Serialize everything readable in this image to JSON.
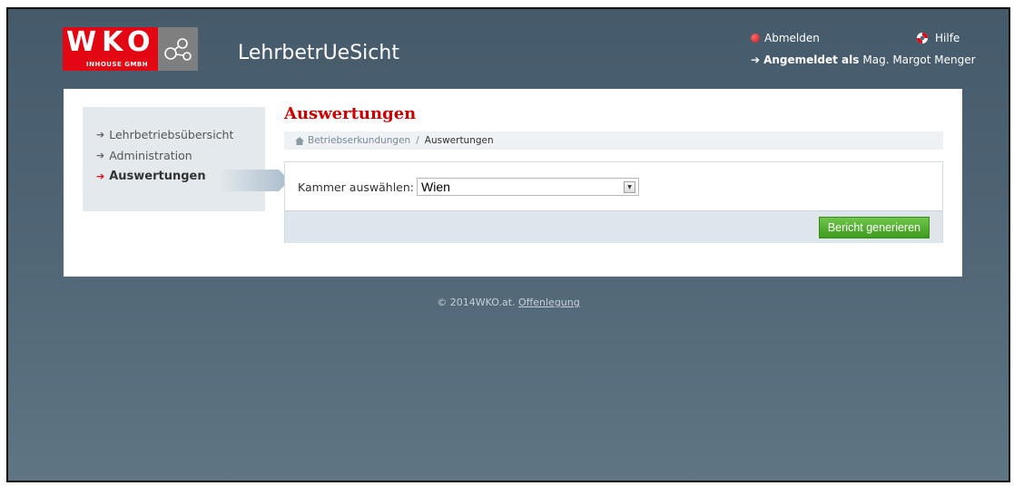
{
  "header": {
    "logo_letters": "WKO",
    "logo_sub": "INHOUSE GMBH",
    "app_title": "LehrbetrUeSicht",
    "logout_label": "Abmelden",
    "help_label": "Hilfe",
    "logged_in_prefix": "Angemeldet als",
    "user_name": "Mag. Margot Menger"
  },
  "sidebar": {
    "items": [
      {
        "label": "Lehrbetriebsübersicht",
        "active": false
      },
      {
        "label": "Administration",
        "active": false
      },
      {
        "label": "Auswertungen",
        "active": true
      }
    ]
  },
  "main": {
    "title": "Auswertungen",
    "breadcrumb": [
      "Betriebserkundungen",
      "Auswertungen"
    ],
    "breadcrumb_separator": "/",
    "form": {
      "chamber_label": "Kammer auswählen:",
      "chamber_value": "Wien",
      "generate_button": "Bericht generieren"
    }
  },
  "footer": {
    "copyright": "© 2014WKO.at.",
    "link": "Offenlegung"
  },
  "colors": {
    "brand_red": "#e30613",
    "title_red": "#cc0000",
    "button_green": "#4caf2a",
    "background_slate": "#4f6474"
  },
  "icons": [
    "logo-rings-icon",
    "logout-dot-icon",
    "lifebuoy-icon",
    "arrow-right-icon",
    "home-icon",
    "select-arrow-icon"
  ]
}
